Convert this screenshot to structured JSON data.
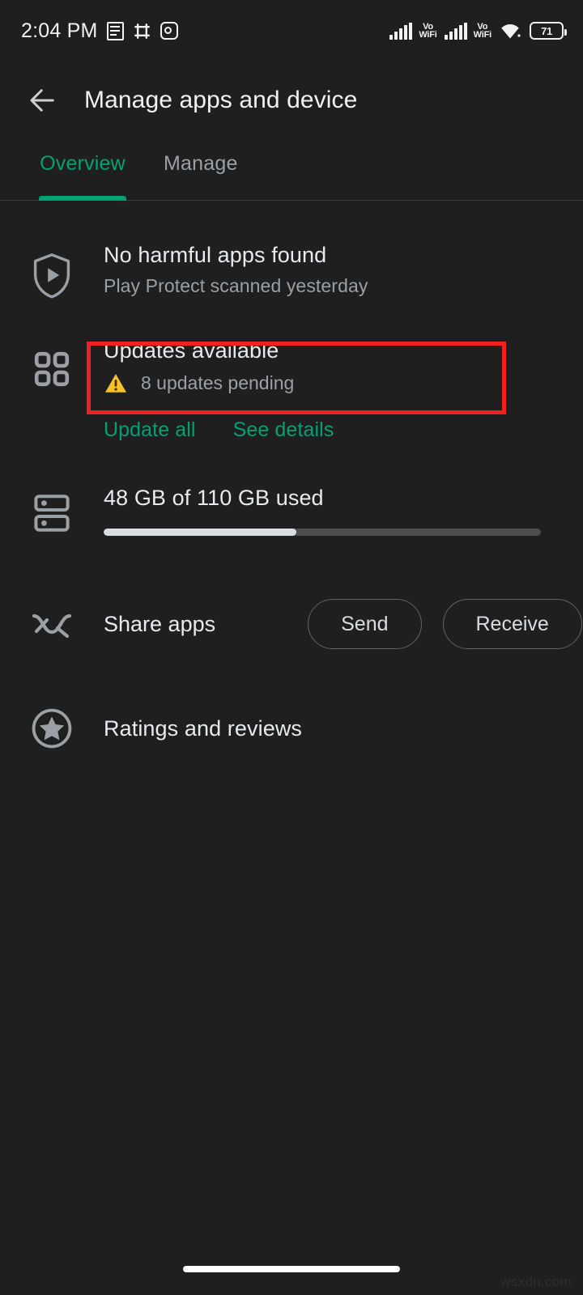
{
  "statusbar": {
    "time": "2:04 PM",
    "left_icons": [
      "notes-icon",
      "slack-icon",
      "instagram-icon"
    ],
    "network_1": {
      "icon": "signal-bars-icon",
      "label_top": "Vo",
      "label_bottom": "WiFi"
    },
    "network_2": {
      "icon": "signal-bars-icon",
      "label_top": "Vo",
      "label_bottom": "WiFi"
    },
    "wifi_icon": "wifi-icon",
    "battery_level": "71"
  },
  "appbar": {
    "back_icon": "back-arrow-icon",
    "title": "Manage apps and device"
  },
  "tabs": [
    {
      "label": "Overview",
      "active": true
    },
    {
      "label": "Manage",
      "active": false
    }
  ],
  "content": {
    "play_protect": {
      "icon": "shield-play-icon",
      "title": "No harmful apps found",
      "subtitle": "Play Protect scanned yesterday"
    },
    "updates": {
      "icon": "apps-grid-icon",
      "title": "Updates available",
      "warning_icon": "warning-triangle-icon",
      "subtitle": "8 updates pending",
      "actions": [
        {
          "label": "Update all"
        },
        {
          "label": "See details"
        }
      ]
    },
    "storage": {
      "icon": "storage-icon",
      "title": "48 GB of 110 GB used",
      "used_gb": 48,
      "total_gb": 110,
      "fill_percent": "44%"
    },
    "share": {
      "icon": "share-apps-icon",
      "title": "Share apps",
      "send_label": "Send",
      "receive_label": "Receive"
    },
    "ratings": {
      "icon": "star-circle-icon",
      "title": "Ratings and reviews"
    }
  },
  "annotation": {
    "highlight_color": "#f32020",
    "target": "Updates available"
  },
  "footer": {
    "watermark": "wsxdn.com"
  },
  "colors": {
    "background": "#1f1f1f",
    "accent_green": "#00a173",
    "warning_amber": "#f5c02a",
    "text_primary": "#e8eaed",
    "text_secondary": "#9aa0a6"
  }
}
